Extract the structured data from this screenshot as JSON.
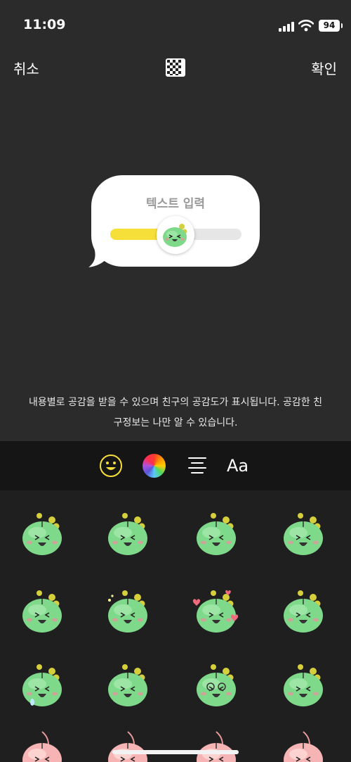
{
  "status_bar": {
    "time": "11:09",
    "battery": "94"
  },
  "nav": {
    "cancel_label": "취소",
    "confirm_label": "확인",
    "background_icon": "checkerboard-icon"
  },
  "preview": {
    "title": "텍스트 입력",
    "slider_value": 0.45,
    "accent_color": "#f7df3a"
  },
  "description": {
    "line1": "내용별로 공감을 받을 수 있으며 친구의 공감도가 표시됩니다. 공감한 친",
    "line2": "구정보는 나만 알 수 있습니다."
  },
  "toolbar": {
    "emoji_icon": "smiley-icon",
    "color_icon": "color-wheel-icon",
    "align_icon": "align-center-icon",
    "font_label": "Aa",
    "active_color": "#f7df3a"
  },
  "stickers": [
    "green-character-laughing",
    "green-character-smiling",
    "green-character-surprised",
    "green-character-sleepy",
    "green-character-small",
    "green-character-blushing",
    "green-character-hearts",
    "green-character-happy",
    "green-character-crying",
    "green-character-tongue",
    "green-character-glasses",
    "green-character-squint",
    "peach-character-laughing",
    "peach-character-smiling",
    "peach-character-nervous",
    "peach-character-grinning"
  ]
}
